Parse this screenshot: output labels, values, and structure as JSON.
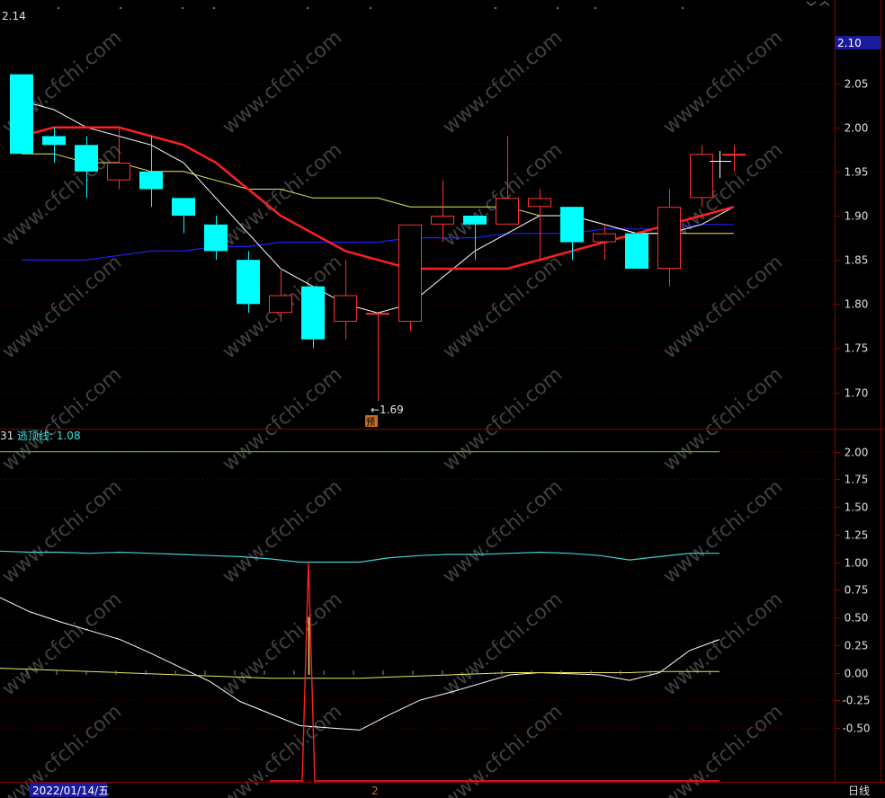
{
  "colors": {
    "background": "#000000",
    "frame": "#8b0000",
    "grid": "#5a0000",
    "axis_text": "#e0e0e0",
    "up_candle": "#ff3030",
    "down_candle": "#00ffff",
    "ma_white": "#ffffff",
    "ma_red": "#ff2020",
    "ma_yellow": "#e8e860",
    "ma_blue": "#2020ff",
    "watermark": "#404040"
  },
  "header": {
    "price_top": "2.14",
    "indicator_left": "31",
    "indicator_name": "逃顶线: 1.08"
  },
  "current_price_tag": "2.10",
  "low_annotation": "←1.69",
  "forecast_badge": "预",
  "footer": {
    "date_tag": "2022/01/14/五",
    "marker_2": "2",
    "period": "日线"
  },
  "watermark_text": "www.cfchi.com",
  "chart_data": [
    {
      "type": "candlestick",
      "y_ticks": [
        "2.05",
        "2.00",
        "1.95",
        "1.90",
        "1.85",
        "1.80",
        "1.75",
        "1.70"
      ],
      "ylim": [
        1.66,
        2.14
      ],
      "low_label": 1.69,
      "candles": [
        {
          "o": 2.06,
          "h": 2.06,
          "l": 1.97,
          "c": 1.97
        },
        {
          "o": 1.99,
          "h": 2.0,
          "l": 1.96,
          "c": 1.98
        },
        {
          "o": 1.98,
          "h": 1.99,
          "l": 1.92,
          "c": 1.95
        },
        {
          "o": 1.94,
          "h": 2.0,
          "l": 1.93,
          "c": 1.96
        },
        {
          "o": 1.95,
          "h": 1.99,
          "l": 1.91,
          "c": 1.93
        },
        {
          "o": 1.92,
          "h": 1.92,
          "l": 1.88,
          "c": 1.9
        },
        {
          "o": 1.89,
          "h": 1.9,
          "l": 1.85,
          "c": 1.86
        },
        {
          "o": 1.85,
          "h": 1.86,
          "l": 1.79,
          "c": 1.8
        },
        {
          "o": 1.79,
          "h": 1.84,
          "l": 1.78,
          "c": 1.81
        },
        {
          "o": 1.82,
          "h": 1.82,
          "l": 1.75,
          "c": 1.76
        },
        {
          "o": 1.78,
          "h": 1.85,
          "l": 1.76,
          "c": 1.81
        },
        {
          "o": 1.79,
          "h": 1.79,
          "l": 1.69,
          "c": 1.79
        },
        {
          "o": 1.78,
          "h": 1.89,
          "l": 1.77,
          "c": 1.89
        },
        {
          "o": 1.89,
          "h": 1.94,
          "l": 1.87,
          "c": 1.9
        },
        {
          "o": 1.9,
          "h": 1.9,
          "l": 1.85,
          "c": 1.89
        },
        {
          "o": 1.89,
          "h": 1.99,
          "l": 1.89,
          "c": 1.92
        },
        {
          "o": 1.91,
          "h": 1.93,
          "l": 1.85,
          "c": 1.92
        },
        {
          "o": 1.91,
          "h": 1.91,
          "l": 1.85,
          "c": 1.87
        },
        {
          "o": 1.87,
          "h": 1.89,
          "l": 1.85,
          "c": 1.88
        },
        {
          "o": 1.88,
          "h": 1.88,
          "l": 1.84,
          "c": 1.84
        },
        {
          "o": 1.84,
          "h": 1.93,
          "l": 1.82,
          "c": 1.91
        },
        {
          "o": 1.92,
          "h": 1.98,
          "l": 1.91,
          "c": 1.97
        },
        {
          "o": 1.97,
          "h": 1.98,
          "l": 1.95,
          "c": 1.97
        }
      ],
      "ma_white": [
        2.03,
        2.02,
        2.0,
        1.99,
        1.98,
        1.96,
        1.92,
        1.88,
        1.84,
        1.82,
        1.8,
        1.79,
        1.8,
        1.83,
        1.86,
        1.88,
        1.9,
        1.9,
        1.89,
        1.88,
        1.88,
        1.89,
        1.91
      ],
      "ma_red": [
        1.99,
        2.0,
        2.0,
        2.0,
        1.99,
        1.98,
        1.96,
        1.93,
        1.9,
        1.88,
        1.86,
        1.85,
        1.84,
        1.84,
        1.84,
        1.84,
        1.85,
        1.86,
        1.87,
        1.88,
        1.89,
        1.9,
        1.91
      ],
      "ma_yellow": [
        1.97,
        1.97,
        1.96,
        1.96,
        1.95,
        1.95,
        1.94,
        1.93,
        1.93,
        1.92,
        1.92,
        1.92,
        1.91,
        1.91,
        1.91,
        1.91,
        1.9,
        1.9,
        1.89,
        1.88,
        1.88,
        1.88,
        1.88
      ],
      "ma_blue": [
        1.85,
        1.85,
        1.85,
        1.855,
        1.86,
        1.86,
        1.865,
        1.865,
        1.87,
        1.87,
        1.87,
        1.87,
        1.875,
        1.875,
        1.875,
        1.88,
        1.88,
        1.88,
        1.885,
        1.885,
        1.885,
        1.89,
        1.89
      ]
    },
    {
      "type": "line",
      "y_ticks": [
        "2.00",
        "1.75",
        "1.50",
        "1.25",
        "1.00",
        "0.75",
        "0.50",
        "0.25",
        "0.00",
        "-0.25",
        "-0.50"
      ],
      "ylim": [
        -0.98,
        2.2
      ],
      "series": [
        {
          "name": "逃顶线",
          "values": [
            1.1,
            1.09,
            1.09,
            1.08,
            1.09,
            1.08,
            1.07,
            1.06,
            1.05,
            1.03,
            1.0,
            1.0,
            1.0,
            1.04,
            1.06,
            1.07,
            1.07,
            1.08,
            1.09,
            1.08,
            1.06,
            1.02,
            1.05,
            1.08,
            1.08
          ]
        },
        {
          "values": [
            2.0,
            2.0
          ]
        },
        {
          "values": [
            0.68,
            0.55,
            0.46,
            0.38,
            0.3,
            0.18,
            0.05,
            -0.08,
            -0.26,
            -0.37,
            -0.48,
            -0.5,
            -0.52,
            -0.38,
            -0.25,
            -0.18,
            -0.1,
            -0.02,
            0.0,
            -0.01,
            -0.02,
            -0.07,
            0.0,
            0.2,
            0.3
          ]
        },
        {
          "values": [
            0.04,
            0.03,
            0.02,
            0.01,
            0.0,
            -0.01,
            -0.02,
            -0.03,
            -0.04,
            -0.05,
            -0.05,
            -0.05,
            -0.05,
            -0.04,
            -0.03,
            -0.02,
            -0.01,
            0.0,
            0.0,
            0.0,
            0.0,
            0.0,
            0.01,
            0.01,
            0.01
          ]
        },
        {
          "values": [
            -0.98,
            -0.98,
            -0.98,
            -0.98,
            1.0,
            -0.98,
            -0.98,
            -0.98
          ]
        },
        {
          "values": [
            0.5,
            -0.02
          ]
        }
      ]
    }
  ]
}
